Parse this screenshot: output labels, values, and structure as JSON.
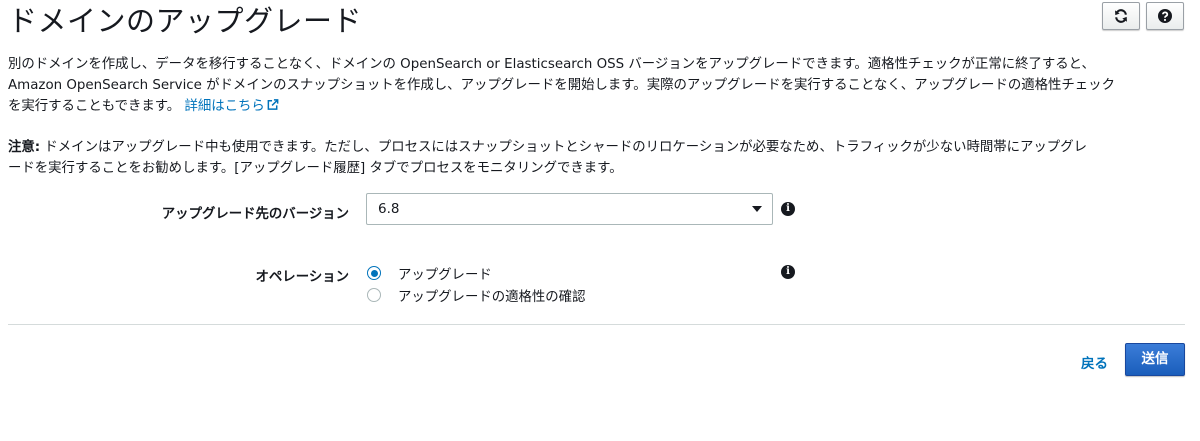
{
  "header": {
    "title": "ドメインのアップグレード",
    "refresh_icon": "refresh-icon",
    "help_icon": "help-icon"
  },
  "description": {
    "line1": "別のドメインを作成し、データを移行することなく、ドメインの OpenSearch or Elasticsearch OSS バージョンをアップグレードできます。適格性チェックが正常に終了すると、",
    "line2": "Amazon OpenSearch Service がドメインのスナップショットを作成し、アップグレードを開始します。実際のアップグレードを実行することなく、アップグレードの適格性チェック",
    "line3": "を実行することもできます。",
    "link_label": "詳細はこちら",
    "link_icon": "external-link-icon"
  },
  "note": {
    "label": "注意:",
    "line1": " ドメインはアップグレード中も使用できます。ただし、プロセスにはスナップショットとシャードのリロケーションが必要なため、トラフィックが少ない時間帯にアップグレ",
    "line2": "ードを実行することをお勧めします。[アップグレード履歴] タブでプロセスをモニタリングできます。"
  },
  "form": {
    "version": {
      "label": "アップグレード先のバージョン",
      "value": "6.8"
    },
    "operation": {
      "label": "オペレーション",
      "options": [
        {
          "label": "アップグレード",
          "selected": true
        },
        {
          "label": "アップグレードの適格性の確認",
          "selected": false
        }
      ]
    }
  },
  "footer": {
    "back_label": "戻る",
    "submit_label": "送信"
  },
  "colors": {
    "link": "#0073bb",
    "primary_button": "#1a5ebb",
    "text": "#16191f"
  }
}
